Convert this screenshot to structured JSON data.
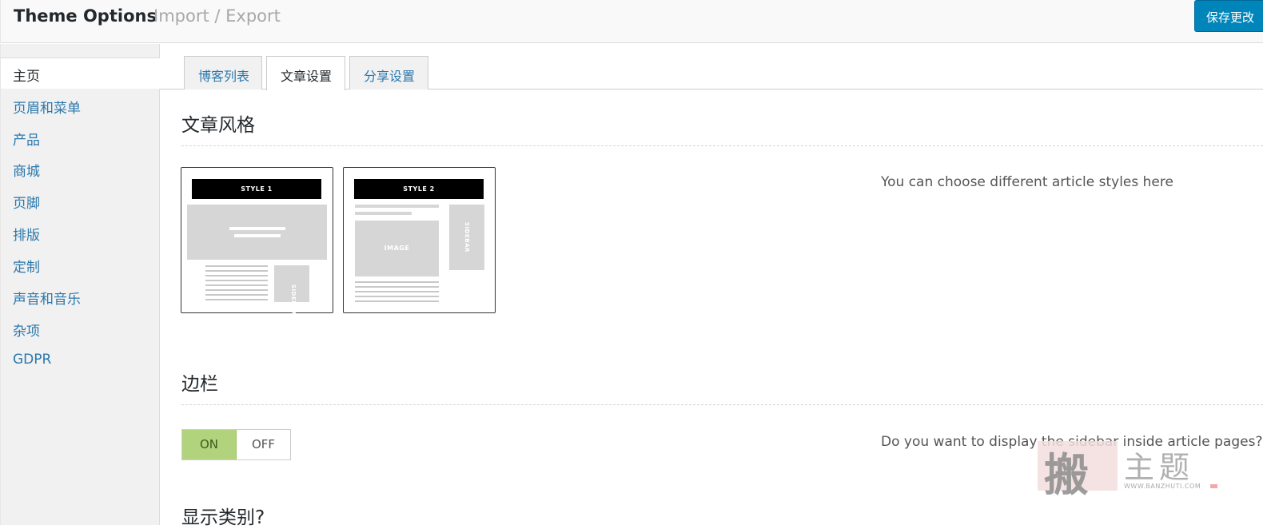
{
  "header": {
    "title": "Theme Options",
    "crumb": "Import / Export",
    "save_label": "保存更改"
  },
  "sidebar": {
    "items": [
      {
        "label": "主页",
        "active": true
      },
      {
        "label": "页眉和菜单",
        "active": false
      },
      {
        "label": "产品",
        "active": false
      },
      {
        "label": "商城",
        "active": false
      },
      {
        "label": "页脚",
        "active": false
      },
      {
        "label": "排版",
        "active": false
      },
      {
        "label": "定制",
        "active": false
      },
      {
        "label": "声音和音乐",
        "active": false
      },
      {
        "label": "杂项",
        "active": false
      },
      {
        "label": "GDPR",
        "active": false
      }
    ]
  },
  "tabs": [
    {
      "label": "博客列表",
      "active": false
    },
    {
      "label": "文章设置",
      "active": true
    },
    {
      "label": "分享设置",
      "active": false
    }
  ],
  "sections": {
    "article_style": {
      "title": "文章风格",
      "description": "You can choose different article styles here",
      "options": [
        {
          "bar_label": "STYLE 1",
          "sidebar_label": "SIDEBAR"
        },
        {
          "bar_label": "STYLE 2",
          "image_label": "IMAGE",
          "sidebar_label": "SIDEBAR"
        }
      ]
    },
    "sidebar": {
      "title": "边栏",
      "description": "Do you want to display the sidebar inside article pages?",
      "toggle": {
        "on_label": "ON",
        "off_label": "OFF",
        "value": "ON"
      }
    },
    "show_categories": {
      "title": "显示类别?"
    }
  },
  "watermark": {
    "seal_char": "搬",
    "chars": "主题",
    "url": "WWW.BANZHUTI.COM"
  },
  "colors": {
    "accent": "#0085ba",
    "link": "#2b78ad",
    "toggle_on": "#b2d37d"
  }
}
